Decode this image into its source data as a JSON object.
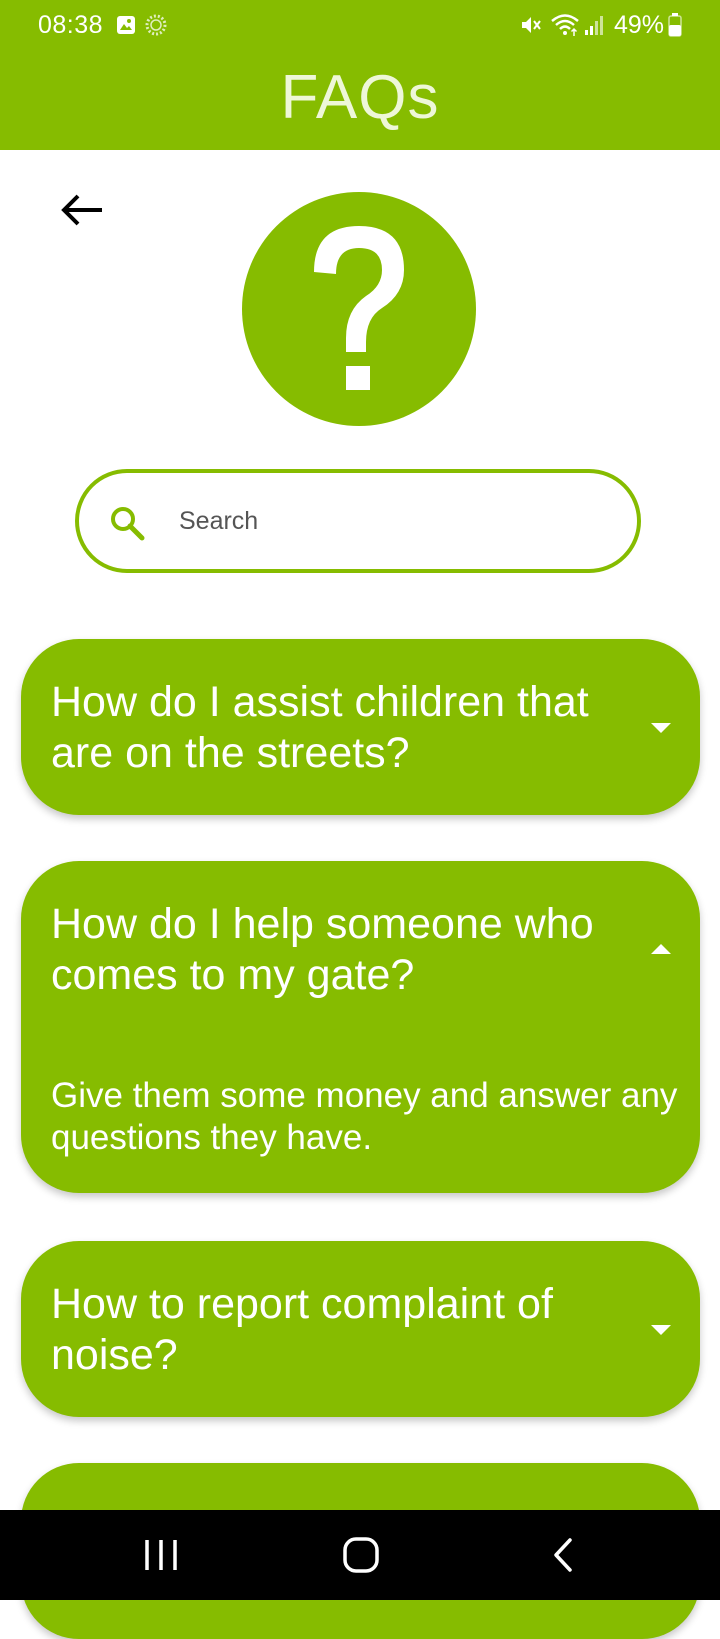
{
  "status_bar": {
    "time": "08:38",
    "battery": "49%",
    "icons": [
      "image-icon",
      "brightness-icon",
      "mute-icon",
      "wifi-icon",
      "signal-icon",
      "battery-icon"
    ]
  },
  "header": {
    "title": "FAQs"
  },
  "back_icon": "arrow-left-icon",
  "hero_icon": "question-mark-icon",
  "search": {
    "placeholder": "Search",
    "value": "",
    "icon": "search-icon"
  },
  "faqs": [
    {
      "question": "How do I assist children that are on the streets?",
      "expanded": false
    },
    {
      "question": "How do I help someone who comes to my gate?",
      "answer": "Give them some money and answer any questions they have.",
      "expanded": true
    },
    {
      "question": "How to report complaint of noise?",
      "expanded": false
    }
  ],
  "nav": [
    "recents-icon",
    "home-icon",
    "back-icon"
  ],
  "colors": {
    "accent": "#86bc00",
    "title_text": "#eef7d8",
    "background": "#ffffff",
    "nav_bar": "#000000"
  }
}
